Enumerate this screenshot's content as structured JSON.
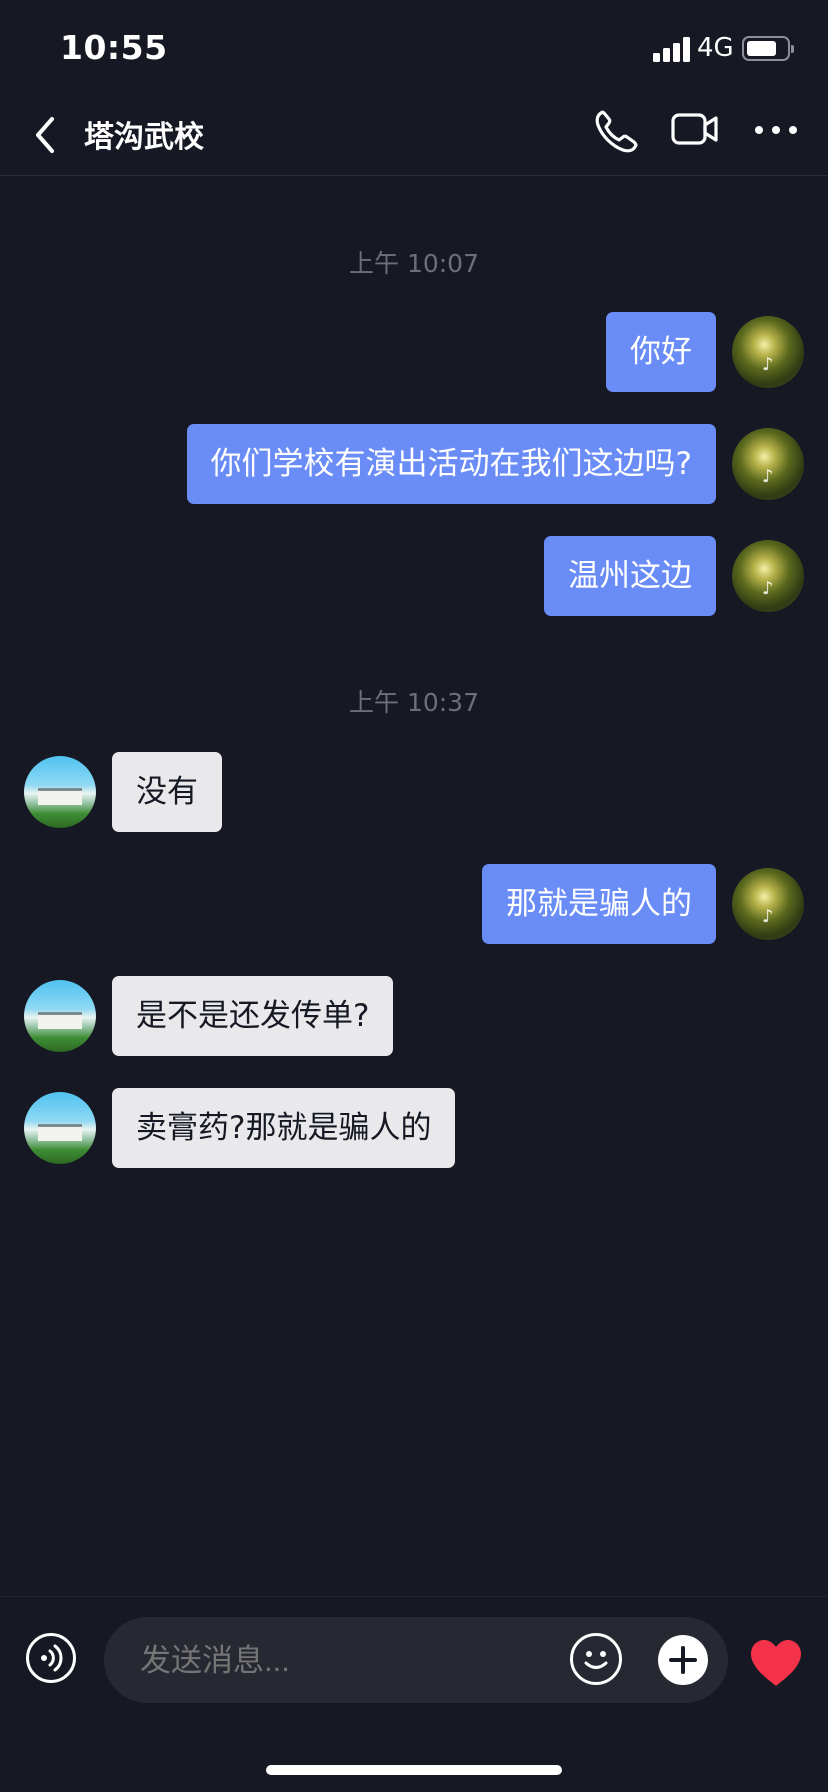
{
  "status_bar": {
    "time": "10:55",
    "network": "4G"
  },
  "header": {
    "title": "塔沟武校",
    "back_icon": "chevron-left-icon",
    "call_icon": "phone-icon",
    "video_icon": "video-camera-icon",
    "more_icon": "more-dots-icon"
  },
  "messages": {
    "ts1": "上午 10:07",
    "m1": "你好",
    "m2": "你们学校有演出活动在我们这边吗?",
    "m3": "温州这边",
    "ts2": "上午 10:37",
    "m4": "没有",
    "m5": "那就是骗人的",
    "m6": "是不是还发传单?",
    "m7": "卖膏药?那就是骗人的"
  },
  "input": {
    "placeholder": "发送消息...",
    "voice_icon": "voice-icon",
    "emoji_icon": "emoji-icon",
    "plus_icon": "plus-icon",
    "heart_icon": "heart-icon"
  },
  "colors": {
    "background": "#161823",
    "my_bubble": "#698cf6",
    "their_bubble": "#e9e9eb",
    "heart": "#f4334a"
  }
}
